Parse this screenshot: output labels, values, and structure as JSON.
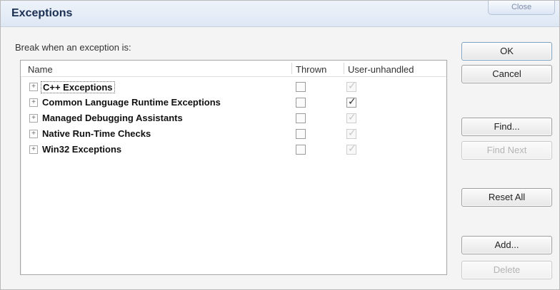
{
  "window": {
    "title": "Exceptions",
    "close_label": "Close"
  },
  "prompt": "Break when an exception is:",
  "columns": {
    "name": "Name",
    "thrown": "Thrown",
    "user_unhandled": "User-unhandled"
  },
  "rows": [
    {
      "label": "C++ Exceptions",
      "thrown": false,
      "user_unhandled": true
    },
    {
      "label": "Common Language Runtime Exceptions",
      "thrown": false,
      "user_unhandled": true
    },
    {
      "label": "Managed Debugging Assistants",
      "thrown": false,
      "user_unhandled": true
    },
    {
      "label": "Native Run-Time Checks",
      "thrown": false,
      "user_unhandled": true
    },
    {
      "label": "Win32 Exceptions",
      "thrown": false,
      "user_unhandled": true
    }
  ],
  "buttons": {
    "ok": "OK",
    "cancel": "Cancel",
    "find": "Find...",
    "find_next": "Find Next",
    "reset_all": "Reset All",
    "add": "Add...",
    "delete": "Delete"
  },
  "icons": {
    "expand": "plus-icon",
    "check": "check-icon"
  }
}
